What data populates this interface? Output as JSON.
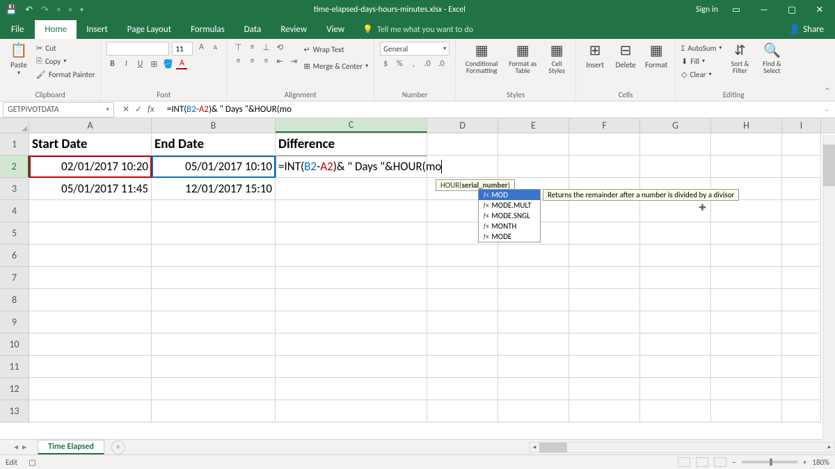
{
  "titlebar": {
    "filename": "time-elapsed-days-hours-minutes.xlsx - Excel",
    "signin": "Sign in"
  },
  "tabs": {
    "file": "File",
    "home": "Home",
    "insert": "Insert",
    "pagelayout": "Page Layout",
    "formulas": "Formulas",
    "data": "Data",
    "review": "Review",
    "view": "View",
    "tellme": "Tell me what you want to do",
    "share": "Share"
  },
  "ribbon": {
    "paste": "Paste",
    "cut": "Cut",
    "copy": "Copy",
    "format_painter": "Format Painter",
    "clipboard": "Clipboard",
    "font_size": "11",
    "font": "Font",
    "alignment": "Alignment",
    "wrap_text": "Wrap Text",
    "merge_center": "Merge & Center",
    "number_fmt": "General",
    "number": "Number",
    "cond_fmt": "Conditional Formatting",
    "fmt_table": "Format as Table",
    "cell_styles": "Cell Styles",
    "styles": "Styles",
    "insert_cells": "Insert",
    "delete_cells": "Delete",
    "format_cells": "Format",
    "cells": "Cells",
    "autosum": "AutoSum",
    "fill": "Fill",
    "clear": "Clear",
    "sort_filter": "Sort & Filter",
    "find_select": "Find & Select",
    "editing": "Editing"
  },
  "namebox": "GETPIVOTDATA",
  "formula": {
    "prefix": "=INT(",
    "ref1": "B2",
    "dash": "-",
    "ref2": "A2",
    "mid": ")& \" Days \"&HOUR(mo"
  },
  "columns": [
    "A",
    "B",
    "C",
    "D",
    "E",
    "F",
    "G",
    "H",
    "I"
  ],
  "headers": {
    "A": "Start Date",
    "B": "End Date",
    "C": "Difference"
  },
  "data_rows": [
    {
      "A": "02/01/2017 10:20",
      "B": "05/01/2017 10:10"
    },
    {
      "A": "05/01/2017 11:45",
      "B": "12/01/2017 15:10"
    }
  ],
  "tooltip": {
    "func": "HOUR(",
    "arg": "serial_number",
    "close": ")"
  },
  "autocomplete": {
    "items": [
      "MOD",
      "MODE.MULT",
      "MODE.SNGL",
      "MONTH",
      "MODE"
    ],
    "selected_desc": "Returns the remainder after a number is divided by a divisor"
  },
  "sheet": {
    "name": "Time Elapsed"
  },
  "status": {
    "mode": "Edit",
    "zoom": "180%"
  }
}
